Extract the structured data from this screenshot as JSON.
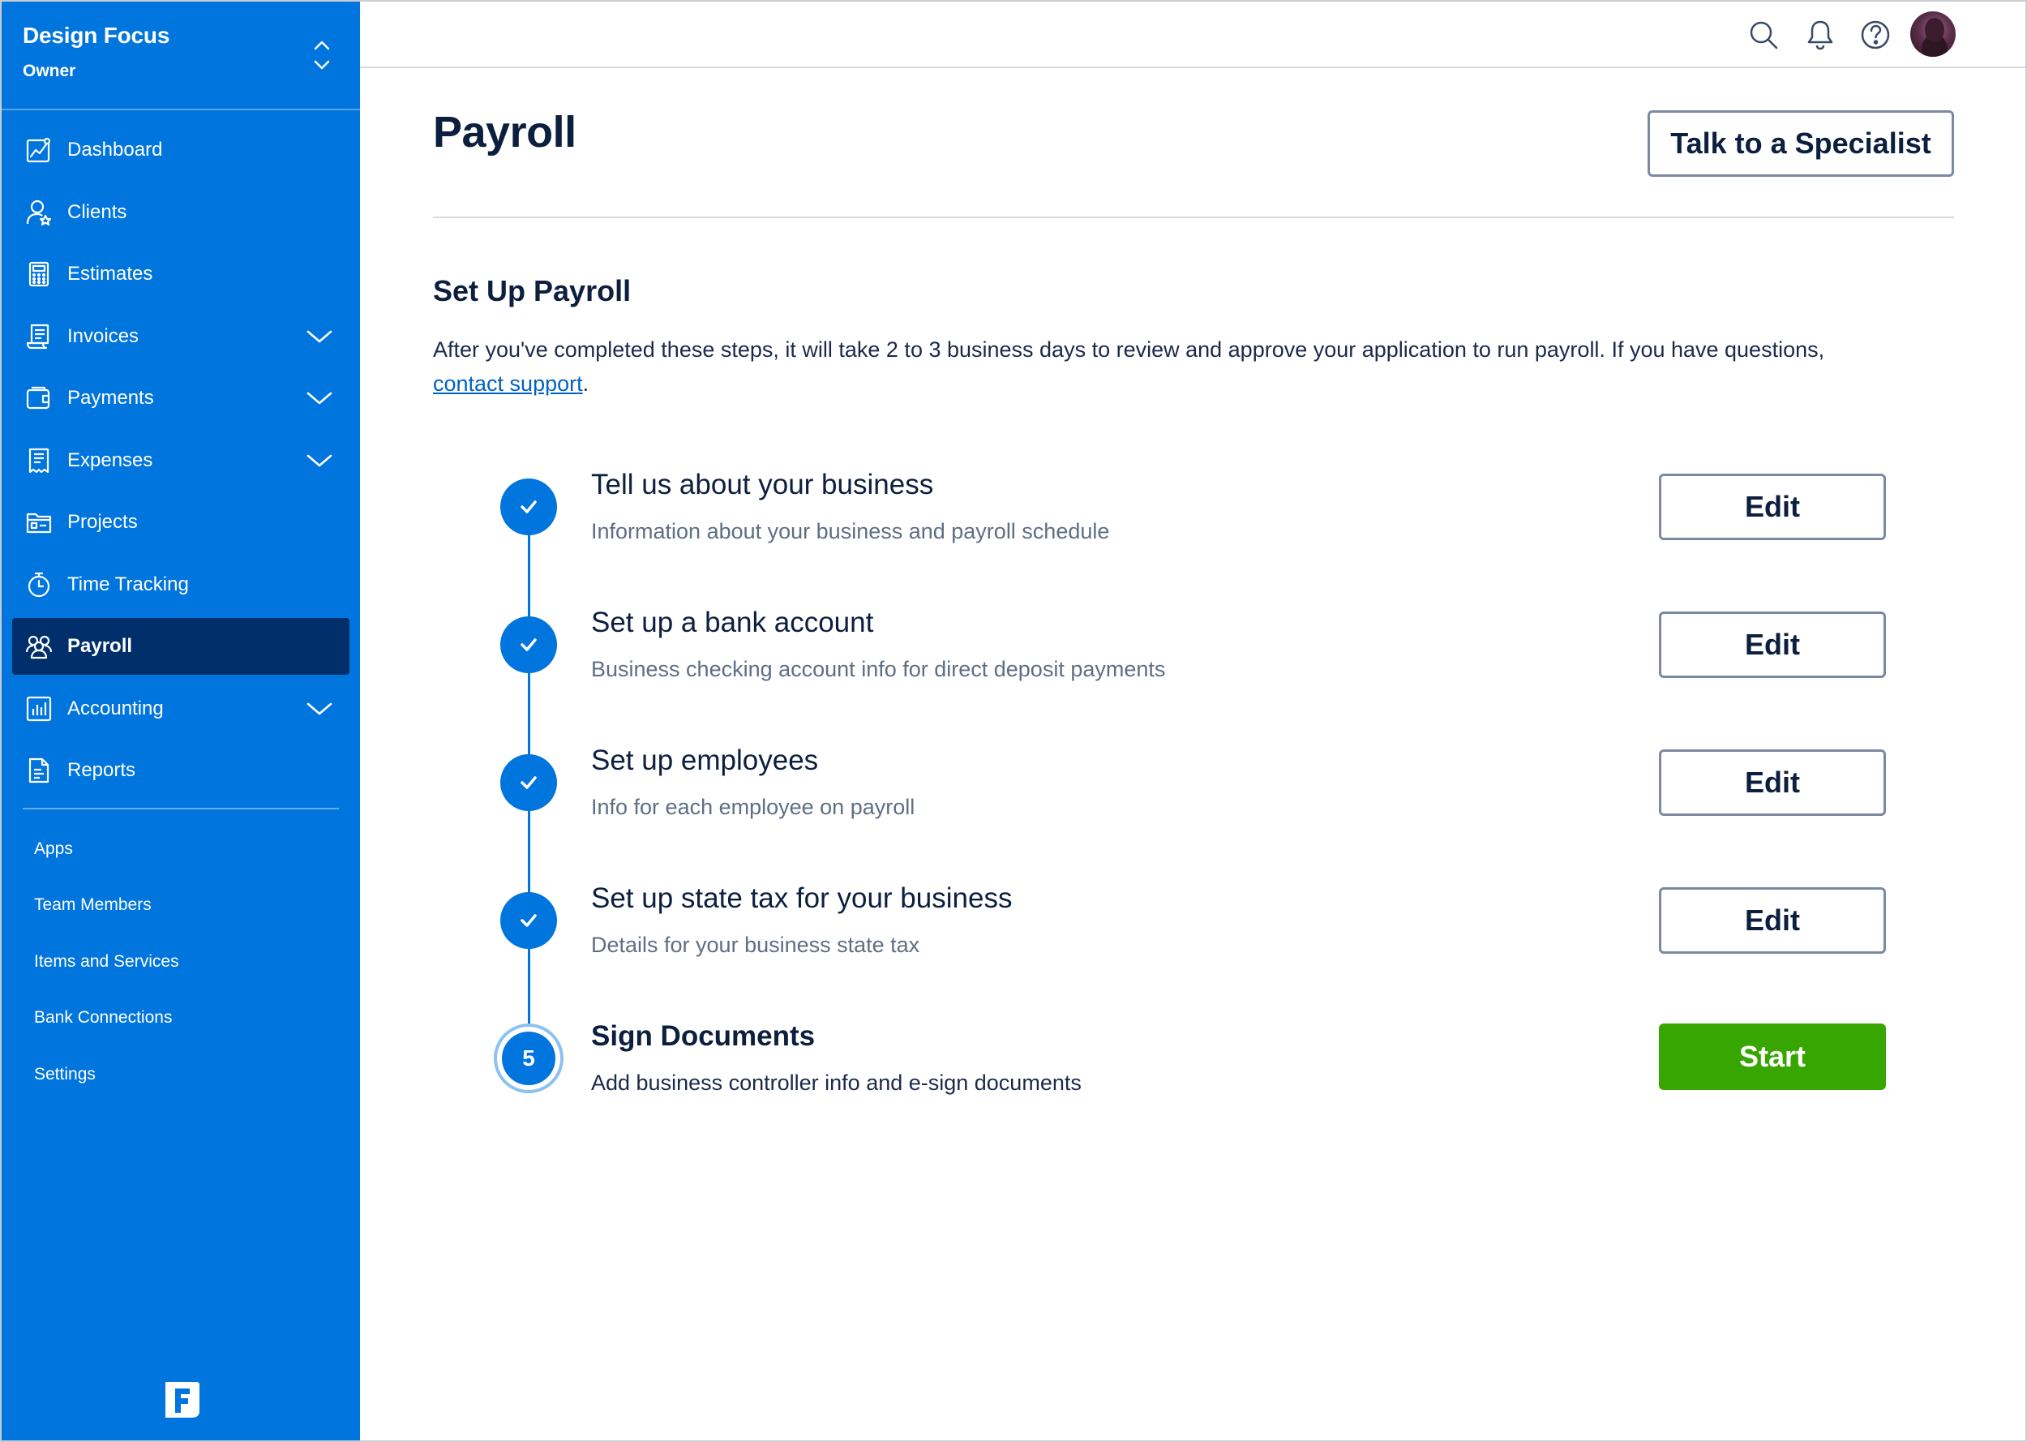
{
  "colors": {
    "sidebar_bg": "#0075dd",
    "sidebar_active": "#002f6c",
    "accent": "#0075dd",
    "start_button": "#37a600",
    "heading": "#0d1f3f"
  },
  "sidebar": {
    "account_name": "Design Focus",
    "account_role": "Owner",
    "nav": [
      {
        "label": "Dashboard",
        "icon": "chart-icon",
        "expandable": false
      },
      {
        "label": "Clients",
        "icon": "user-star-icon",
        "expandable": false
      },
      {
        "label": "Estimates",
        "icon": "calculator-icon",
        "expandable": false
      },
      {
        "label": "Invoices",
        "icon": "invoice-icon",
        "expandable": true
      },
      {
        "label": "Payments",
        "icon": "wallet-icon",
        "expandable": true
      },
      {
        "label": "Expenses",
        "icon": "receipt-icon",
        "expandable": true
      },
      {
        "label": "Projects",
        "icon": "folder-icon",
        "expandable": false
      },
      {
        "label": "Time Tracking",
        "icon": "stopwatch-icon",
        "expandable": false
      },
      {
        "label": "Payroll",
        "icon": "people-icon",
        "expandable": false,
        "active": true
      },
      {
        "label": "Accounting",
        "icon": "bar-chart-icon",
        "expandable": true
      },
      {
        "label": "Reports",
        "icon": "report-icon",
        "expandable": false
      }
    ],
    "secondary": [
      "Apps",
      "Team Members",
      "Items and Services",
      "Bank Connections",
      "Settings"
    ]
  },
  "topbar": {
    "icons": [
      "search-icon",
      "bell-icon",
      "help-icon",
      "avatar"
    ]
  },
  "main": {
    "title": "Payroll",
    "specialist_button": "Talk to a Specialist",
    "section_title": "Set Up Payroll",
    "intro_text": "After you've completed these steps, it will take 2 to 3 business days to review and approve your application to run payroll. If you have questions,",
    "intro_link": "contact support",
    "intro_end": ".",
    "steps": [
      {
        "title": "Tell us about your business",
        "description": "Information about your business and payroll schedule",
        "status": "complete",
        "action": "Edit"
      },
      {
        "title": "Set up a bank account",
        "description": "Business checking account info for direct deposit payments",
        "status": "complete",
        "action": "Edit"
      },
      {
        "title": "Set up employees",
        "description": "Info for each employee on payroll",
        "status": "complete",
        "action": "Edit"
      },
      {
        "title": "Set up state tax for your business",
        "description": "Details for your business state tax",
        "status": "complete",
        "action": "Edit"
      },
      {
        "number": "5",
        "title": "Sign Documents",
        "description": "Add business controller info and e-sign documents",
        "status": "current",
        "action": "Start"
      }
    ]
  }
}
